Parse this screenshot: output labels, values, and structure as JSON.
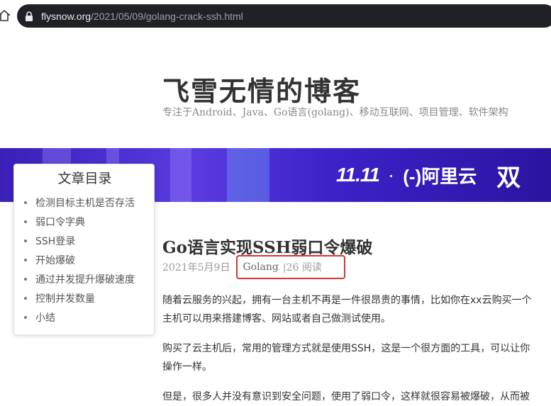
{
  "browser": {
    "url_host": "flysnow.org",
    "url_path": "/2021/05/09/golang-crack-ssh.html"
  },
  "header": {
    "title": "飞雪无情的博客",
    "description": "专注于Android、Java、Go语言(golang)、移动互联网、项目管理、软件架构"
  },
  "banner": {
    "event": "11.11",
    "dot": "·",
    "brand": "(-)阿里云",
    "tail": "双"
  },
  "toc": {
    "title": "文章目录",
    "items": [
      {
        "label": "检测目标主机是否存活"
      },
      {
        "label": "弱口令字典"
      },
      {
        "label": "SSH登录"
      },
      {
        "label": "开始爆破"
      },
      {
        "label": "通过并发提升爆破速度"
      },
      {
        "label": "控制并发数量"
      },
      {
        "label": "小结"
      }
    ]
  },
  "post": {
    "title": "Go语言实现SSH弱口令爆破",
    "date": "2021年5月9日",
    "category": "Golang",
    "views": "|26 阅读",
    "paragraphs": [
      "随着云服务的兴起，拥有一台主机不再是一件很昂贵的事情，比如你在xx云购买一个",
      "主机可以用来搭建博客、网站或者自己做测试使用。",
      "购买了云主机后，常用的管理方式就是使用SSH，这是一个很方面的工具，可以让你",
      "操作一样。",
      "但是，很多人并没有意识到安全问题，使用了弱口令，这样就很容易被爆破，从而被"
    ]
  },
  "colors": {
    "highlight": "#d9352b",
    "banner": "#4a2fd0"
  }
}
